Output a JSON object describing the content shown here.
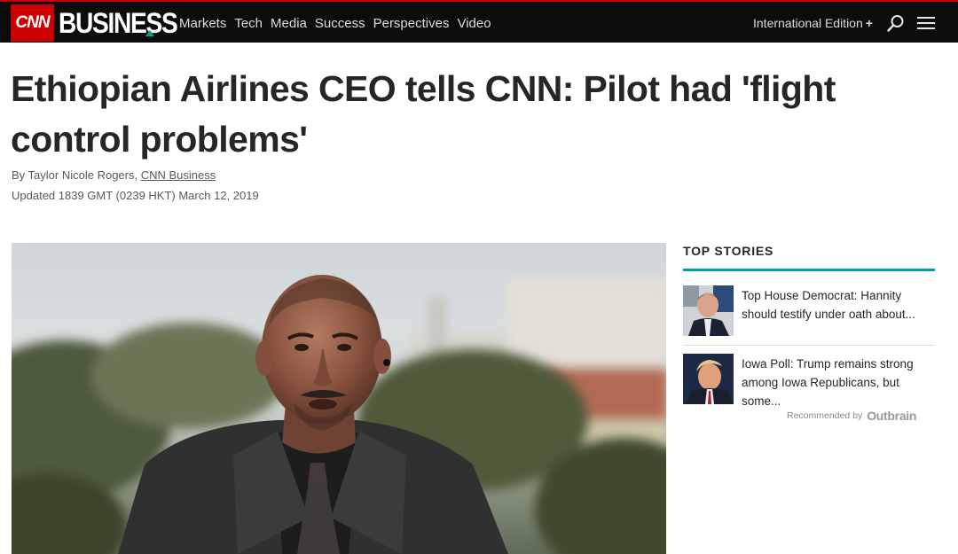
{
  "header": {
    "logo": "CNN",
    "section": "BUSINESS",
    "nav": [
      "Markets",
      "Tech",
      "Media",
      "Success",
      "Perspectives",
      "Video"
    ],
    "edition": "International Edition",
    "edition_suffix": "+"
  },
  "article": {
    "headline": "Ethiopian Airlines CEO tells CNN: Pilot had 'flight control problems'",
    "byline_prefix": "By Taylor Nicole Rogers, ",
    "byline_link": "CNN Business",
    "updated": "Updated 1839 GMT (0239 HKT) March 12, 2019"
  },
  "sidebar": {
    "title": "TOP STORIES",
    "stories": [
      {
        "text": "Top House Democrat: Hannity should testify under oath about..."
      },
      {
        "text": "Iowa Poll: Trump remains strong among Iowa Republicans, but some..."
      }
    ],
    "recommended_label": "Recommended by",
    "recommended_brand": "Outbrain"
  },
  "colors": {
    "brand_red": "#cc0000",
    "accent_teal": "#00a1a1",
    "topbar_bg": "#0c0c0c"
  }
}
